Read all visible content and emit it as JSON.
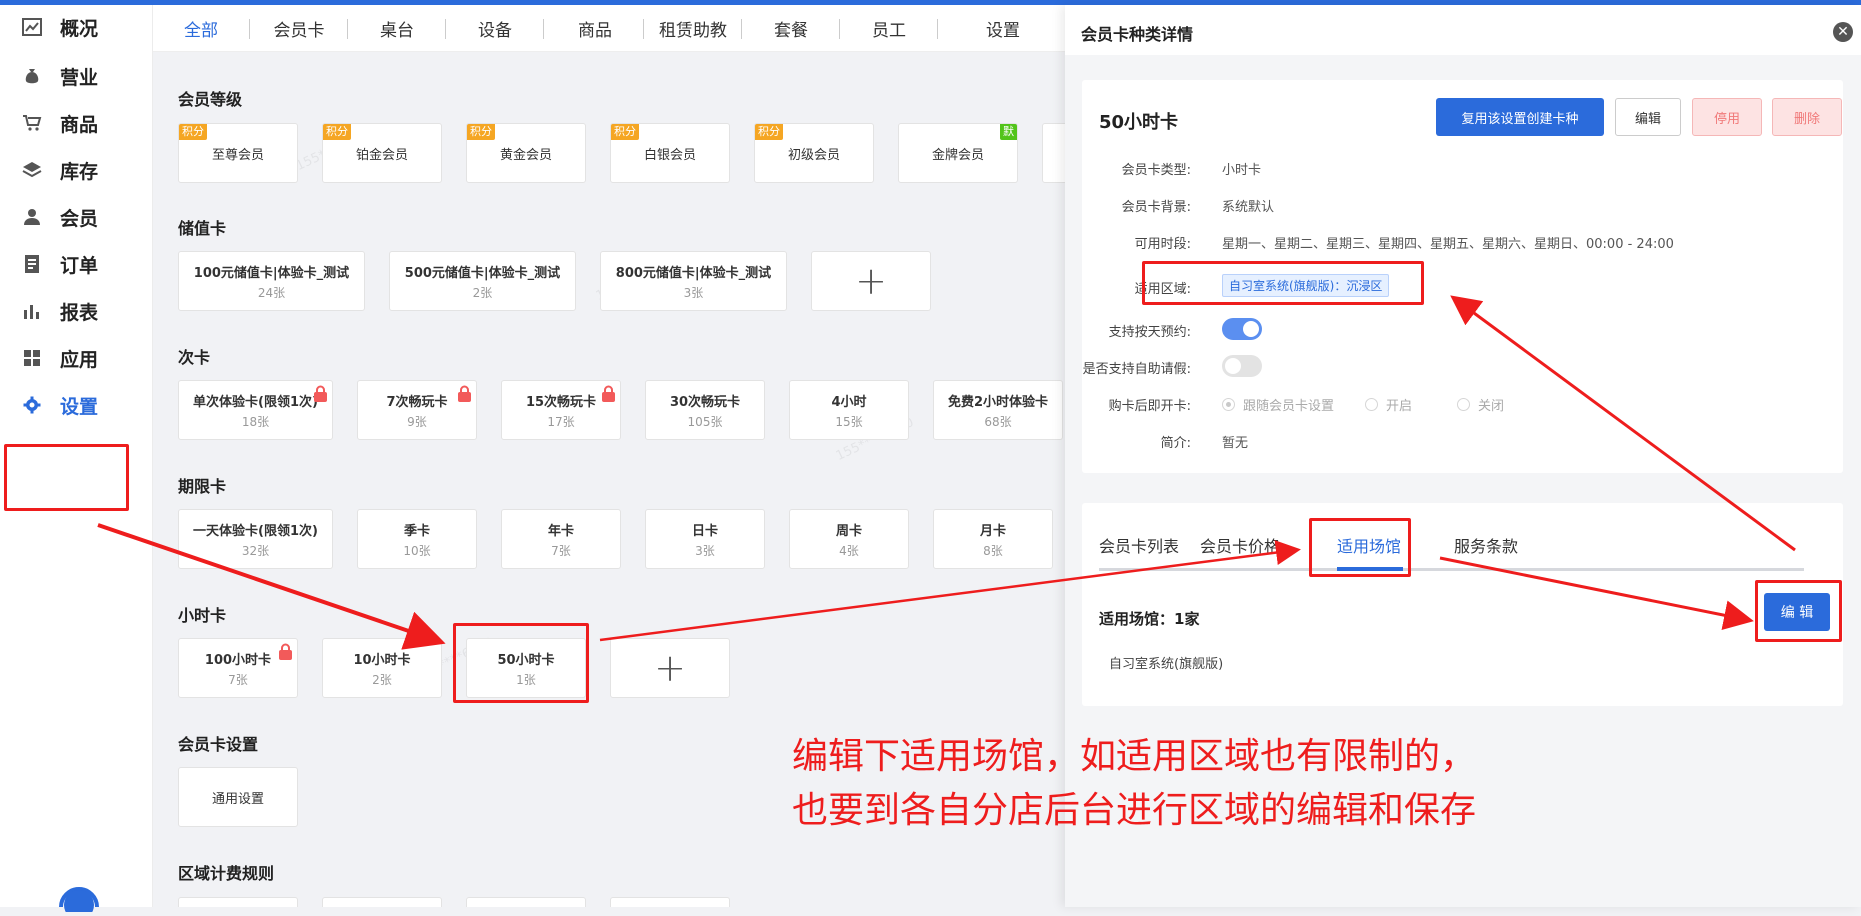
{
  "sidebar": {
    "items": [
      {
        "label": "概况",
        "icon": "chart-icon"
      },
      {
        "label": "营业",
        "icon": "money-bag-icon"
      },
      {
        "label": "商品",
        "icon": "cart-icon"
      },
      {
        "label": "库存",
        "icon": "layers-icon"
      },
      {
        "label": "会员",
        "icon": "user-icon"
      },
      {
        "label": "订单",
        "icon": "order-icon"
      },
      {
        "label": "报表",
        "icon": "bar-chart-icon"
      },
      {
        "label": "应用",
        "icon": "apps-icon"
      },
      {
        "label": "设置",
        "icon": "gear-icon"
      }
    ],
    "active": "设置"
  },
  "tabs": [
    "全部",
    "会员卡",
    "桌台",
    "设备",
    "商品",
    "租赁助教",
    "套餐",
    "员工",
    "设置"
  ],
  "active_tab": "全部",
  "watermark": "155****6170",
  "sections": {
    "levels": {
      "title": "会员等级",
      "cards": [
        {
          "name": "至尊会员",
          "badge": "积分"
        },
        {
          "name": "铂金会员",
          "badge": "积分"
        },
        {
          "name": "黄金会员",
          "badge": "积分"
        },
        {
          "name": "白银会员",
          "badge": "积分"
        },
        {
          "name": "初级会员",
          "badge": "积分"
        },
        {
          "name": "金牌会员",
          "badge": "默"
        }
      ]
    },
    "stored": {
      "title": "储值卡",
      "cards": [
        {
          "name": "100元储值卡|体验卡_测试",
          "count": "24张"
        },
        {
          "name": "500元储值卡|体验卡_测试",
          "count": "2张"
        },
        {
          "name": "800元储值卡|体验卡_测试",
          "count": "3张"
        }
      ],
      "add": "+"
    },
    "times": {
      "title": "次卡",
      "cards": [
        {
          "name": "单次体验卡(限领1次)",
          "count": "18张",
          "locked": true
        },
        {
          "name": "7次畅玩卡",
          "count": "9张",
          "locked": true
        },
        {
          "name": "15次畅玩卡",
          "count": "17张",
          "locked": true
        },
        {
          "name": "30次畅玩卡",
          "count": "105张",
          "locked": false
        },
        {
          "name": "4小时",
          "count": "15张",
          "locked": false
        },
        {
          "name": "免费2小时体验卡",
          "count": "68张",
          "locked": false
        }
      ]
    },
    "period": {
      "title": "期限卡",
      "cards": [
        {
          "name": "一天体验卡(限领1次)",
          "count": "32张"
        },
        {
          "name": "季卡",
          "count": "10张"
        },
        {
          "name": "年卡",
          "count": "7张"
        },
        {
          "name": "日卡",
          "count": "3张"
        },
        {
          "name": "周卡",
          "count": "4张"
        },
        {
          "name": "月卡",
          "count": "8张"
        }
      ]
    },
    "hourly": {
      "title": "小时卡",
      "cards": [
        {
          "name": "100小时卡",
          "count": "7张",
          "locked": true
        },
        {
          "name": "10小时卡",
          "count": "2张",
          "locked": false
        },
        {
          "name": "50小时卡",
          "count": "1张",
          "locked": false
        }
      ],
      "add": "+"
    },
    "settings": {
      "title": "会员卡设置",
      "cards": [
        {
          "name": "通用设置"
        }
      ]
    },
    "zone": {
      "title": "区域计费规则"
    }
  },
  "panel": {
    "title": "会员卡种类详情",
    "close": "✕",
    "card_title": "50小时卡",
    "buttons": {
      "copy": "复用该设置创建卡种",
      "edit": "编辑",
      "disable": "停用",
      "delete": "删除"
    },
    "fields": {
      "type_label": "会员卡类型:",
      "type_value": "小时卡",
      "bg_label": "会员卡背景:",
      "bg_value": "系统默认",
      "time_label": "可用时段:",
      "time_value": "星期一、星期二、星期三、星期四、星期五、星期六、星期日、00:00 - 24:00",
      "area_label": "适用区域:",
      "area_value": "自习室系统(旗舰版)：沉浸区",
      "reserve_label": "支持按天预约:",
      "reserve_on": true,
      "leave_label": "是否支持自助请假:",
      "leave_on": false,
      "open_label": "购卡后即开卡:",
      "open_options": [
        "跟随会员卡设置",
        "开启",
        "关闭"
      ],
      "open_selected": "跟随会员卡设置",
      "intro_label": "简介:",
      "intro_value": "暂无"
    },
    "tabs": [
      "会员卡列表",
      "会员卡价格",
      "适用场馆",
      "服务条款"
    ],
    "active_tab": "适用场馆",
    "venue_title": "适用场馆：1家",
    "venue_item": "自习室系统(旗舰版)",
    "venue_edit": "编 辑"
  },
  "annotation": {
    "line1": "编辑下适用场馆，如适用区域也有限制的，",
    "line2": "也要到各自分店后台进行区域的编辑和保存",
    "color": "#ee1d1d"
  },
  "colors": {
    "accent": "#2b6bdb",
    "badge": "#f5a623",
    "lock": "#f25a5a"
  }
}
